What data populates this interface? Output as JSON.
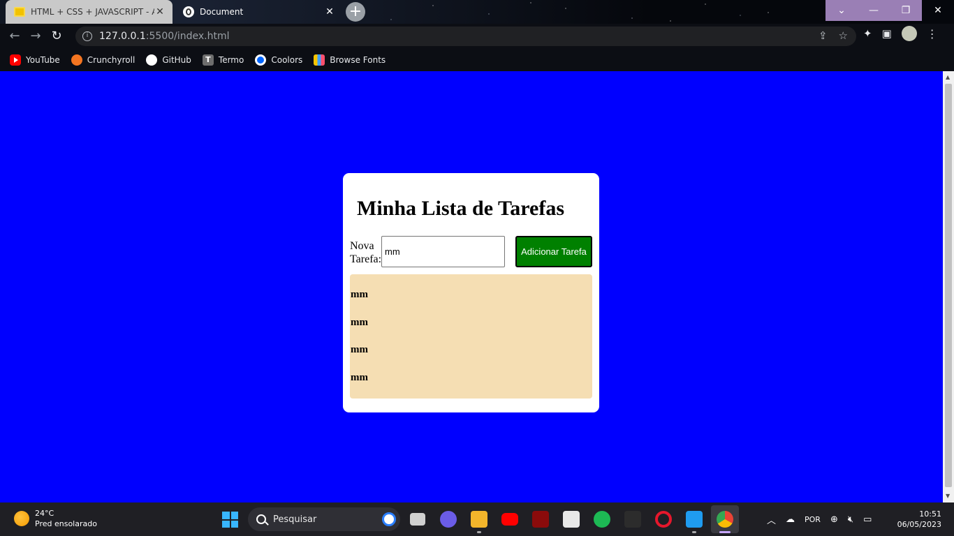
{
  "browser": {
    "tabs": [
      {
        "title": "HTML + CSS + JAVASCRIPT - Ap",
        "active": true
      },
      {
        "title": "Document",
        "active": false
      }
    ],
    "url_host": "127.0.0.1",
    "url_rest": ":5500/index.html",
    "bookmarks": [
      {
        "label": "YouTube",
        "icon": "youtube-icon"
      },
      {
        "label": "Crunchyroll",
        "icon": "crunchyroll-icon"
      },
      {
        "label": "GitHub",
        "icon": "github-icon"
      },
      {
        "label": "Termo",
        "icon": "termo-icon"
      },
      {
        "label": "Coolors",
        "icon": "coolors-icon"
      },
      {
        "label": "Browse Fonts",
        "icon": "browse-fonts-icon"
      }
    ]
  },
  "page": {
    "background": "#0000ff",
    "title": "Minha Lista de Tarefas",
    "input_label": "Nova Tarefa:",
    "input_value": "mm",
    "add_button": "Adicionar Tarefa",
    "add_button_color": "#008000",
    "list_background": "#f5deb3",
    "tasks": [
      "mm",
      "mm",
      "mm",
      "mm"
    ]
  },
  "taskbar": {
    "weather_temp": "24°C",
    "weather_desc": "Pred ensolarado",
    "search_placeholder": "Pesquisar",
    "language": "POR",
    "time": "10:51",
    "date": "06/05/2023"
  }
}
